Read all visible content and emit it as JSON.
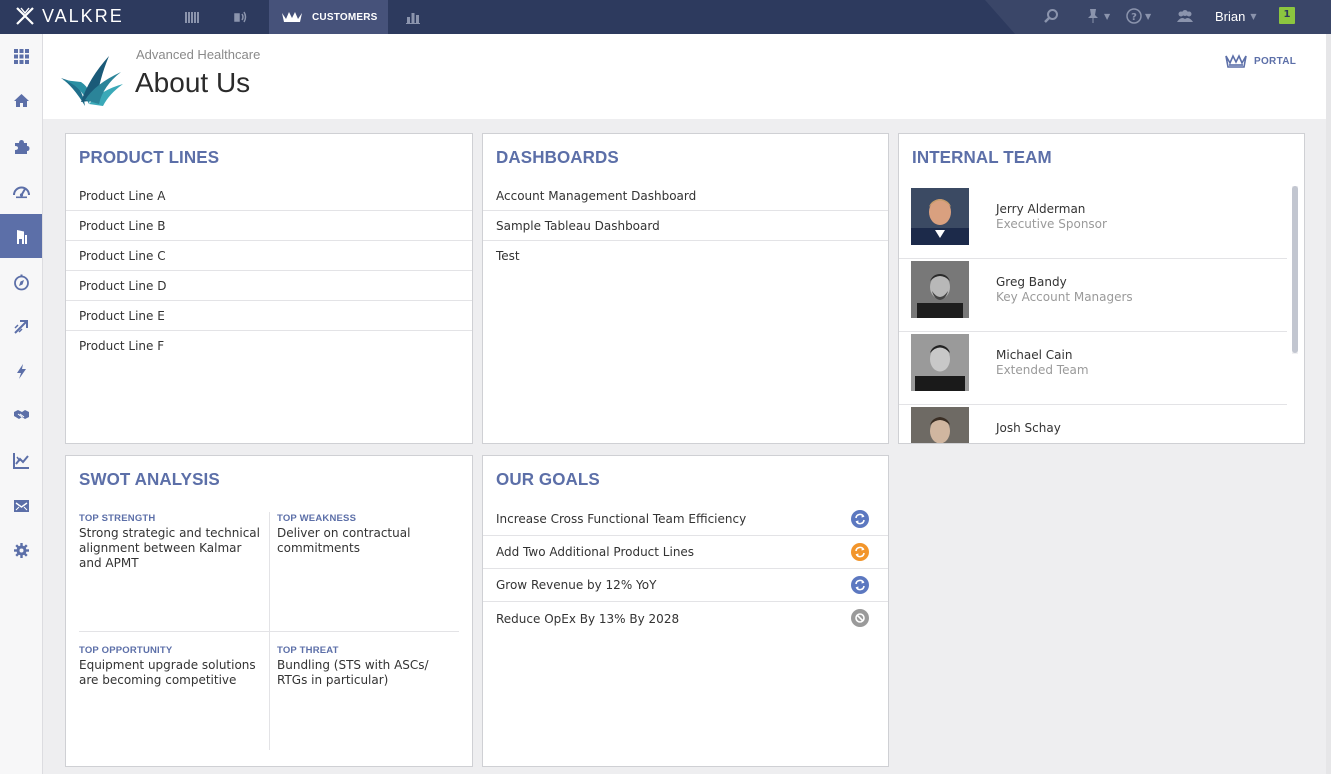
{
  "app": {
    "brand": "VALKRE"
  },
  "topnav": {
    "active_tab": "CUSTOMERS",
    "user": "Brian",
    "notification_count": "1",
    "icons": [
      "dashboard-grid-icon",
      "broadcast-icon",
      "crown-icon",
      "bar-chart-icon",
      "search-icon",
      "pin-icon",
      "help-icon",
      "group-icon"
    ]
  },
  "sidebar": {
    "icons": [
      "apps-icon",
      "home-icon",
      "puzzle-icon",
      "gauge-icon",
      "building-icon",
      "compass-icon",
      "arrow-up-right-icon",
      "lightning-icon",
      "handshake-icon",
      "chart-line-icon",
      "inbox-icon",
      "gear-icon"
    ],
    "active": "building-icon"
  },
  "header": {
    "subtitle": "Advanced Healthcare",
    "title": "About Us",
    "portal_label": "PORTAL"
  },
  "product_lines": {
    "title": "PRODUCT LINES",
    "items": [
      "Product Line A",
      "Product Line B",
      "Product Line C",
      "Product Line D",
      "Product Line E",
      "Product Line F"
    ]
  },
  "dashboards": {
    "title": "DASHBOARDS",
    "items": [
      "Account Management Dashboard",
      "Sample Tableau Dashboard",
      "Test"
    ]
  },
  "internal_team": {
    "title": "INTERNAL TEAM",
    "members": [
      {
        "name": "Jerry Alderman",
        "role": "Executive Sponsor"
      },
      {
        "name": "Greg Bandy",
        "role": "Key Account Managers"
      },
      {
        "name": "Michael Cain",
        "role": "Extended Team"
      },
      {
        "name": "Josh Schay",
        "role": ""
      }
    ]
  },
  "swot": {
    "title": "SWOT ANALYSIS",
    "strength": {
      "label": "TOP STRENGTH",
      "text": "Strong strategic and technical alignment between Kalmar and APMT"
    },
    "weakness": {
      "label": "TOP WEAKNESS",
      "text": "Deliver on contractual commitments"
    },
    "opportunity": {
      "label": "TOP OPPORTUNITY",
      "text": "Equipment upgrade solutions are becoming competitive"
    },
    "threat": {
      "label": "TOP THREAT",
      "text": "Bundling (STS with ASCs/ RTGs in particular)"
    }
  },
  "goals": {
    "title": "OUR GOALS",
    "items": [
      {
        "text": "Increase Cross Functional Team Efficiency",
        "status": "in-progress",
        "color": "#5c78c0"
      },
      {
        "text": "Add Two Additional Product Lines",
        "status": "at-risk",
        "color": "#f2952b"
      },
      {
        "text": "Grow Revenue by 12% YoY",
        "status": "in-progress",
        "color": "#5c78c0"
      },
      {
        "text": "Reduce OpEx By 13% By 2028",
        "status": "not-started",
        "color": "#9a9a9a"
      }
    ]
  },
  "colors": {
    "topbar": "#2d3a5e",
    "accent": "#5c6fa8",
    "notification": "#8cc63f"
  }
}
